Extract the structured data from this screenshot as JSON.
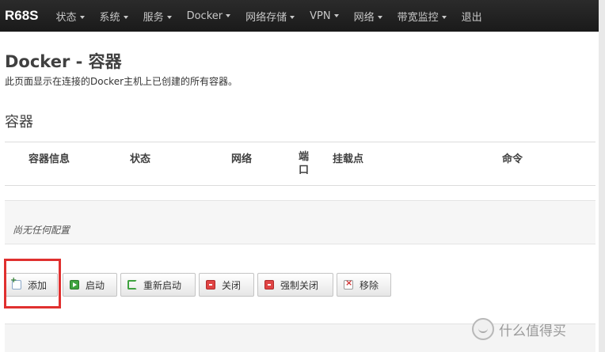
{
  "navbar": {
    "brand": "R68S",
    "items": [
      {
        "label": "状态"
      },
      {
        "label": "系统"
      },
      {
        "label": "服务"
      },
      {
        "label": "Docker"
      },
      {
        "label": "网络存储"
      },
      {
        "label": "VPN"
      },
      {
        "label": "网络"
      },
      {
        "label": "带宽监控"
      },
      {
        "label": "退出"
      }
    ]
  },
  "page": {
    "title": "Docker - 容器",
    "description": "此页面显示在连接的Docker主机上已创建的所有容器。"
  },
  "section": {
    "title": "容器"
  },
  "table": {
    "columns": [
      "容器信息",
      "状态",
      "网络",
      "端口",
      "挂载点",
      "命令"
    ],
    "empty_text": "尚无任何配置"
  },
  "actions": [
    {
      "label": "添加",
      "icon": "add-icon"
    },
    {
      "label": "启动",
      "icon": "play-icon"
    },
    {
      "label": "重新启动",
      "icon": "restart-icon"
    },
    {
      "label": "关闭",
      "icon": "stop-icon"
    },
    {
      "label": "强制关闭",
      "icon": "kill-icon"
    },
    {
      "label": "移除",
      "icon": "remove-icon"
    }
  ],
  "colors": {
    "navbar_bg": "#1f1f1f",
    "highlight": "#e0302f"
  },
  "watermark": {
    "text": "什么值得买"
  }
}
